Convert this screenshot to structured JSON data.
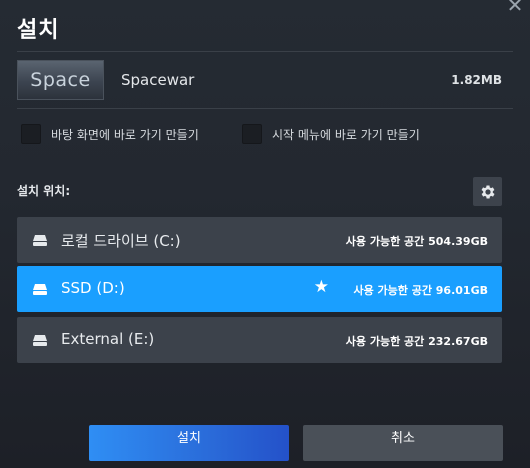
{
  "dialog": {
    "title": "설치",
    "close_glyph": "✕"
  },
  "game": {
    "thumbnail_text": "Space",
    "name": "Spacewar",
    "size": "1.82MB"
  },
  "options": [
    {
      "label": "바탕 화면에 바로 가기 만들기",
      "checked": false
    },
    {
      "label": "시작 메뉴에 바로 가기 만들기",
      "checked": false
    }
  ],
  "install_location": {
    "label": "설치 위치:",
    "settings_icon": "gear-icon"
  },
  "drives": [
    {
      "name": "로컬 드라이브 (C:)",
      "space": "사용 가능한 공간 504.39GB",
      "selected": false,
      "favorite": false
    },
    {
      "name": "SSD (D:)",
      "space": "사용 가능한 공간 96.01GB",
      "selected": true,
      "favorite": true
    },
    {
      "name": "External (E:)",
      "space": "사용 가능한 공간 232.67GB",
      "selected": false,
      "favorite": false
    }
  ],
  "buttons": {
    "install": "설치",
    "cancel": "취소"
  },
  "colors": {
    "accent": "#1a9fff",
    "drive_bg": "#3c424b",
    "install_gradient_start": "#2f8ef4",
    "install_gradient_end": "#2451c9",
    "cancel_bg": "#4a5058"
  }
}
